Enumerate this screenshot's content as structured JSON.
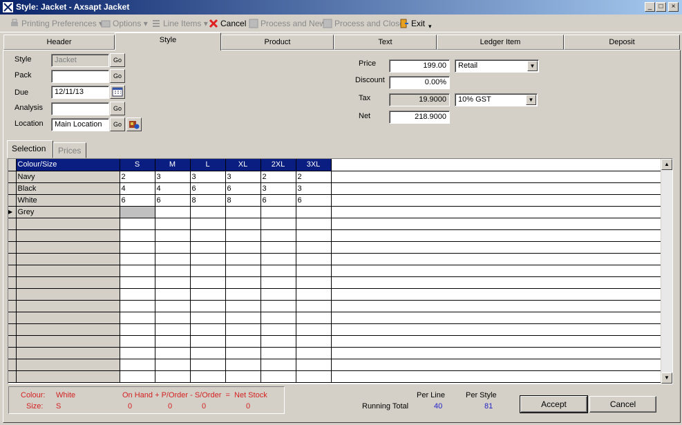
{
  "window": {
    "title": "Style: Jacket - Axsapt Jacket",
    "min": "_",
    "max": "□",
    "close": "×"
  },
  "toolbar": {
    "printing": "Printing Preferences ▾",
    "options": "Options ▾",
    "line_items": "Line Items ▾",
    "cancel": "Cancel",
    "process_new": "Process and New",
    "process_close": "Process and Close",
    "exit": "Exit",
    "more": "▾"
  },
  "tabs": [
    "Header",
    "Style",
    "Product",
    "Text",
    "Ledger Item",
    "Deposit"
  ],
  "form": {
    "style_label": "Style",
    "style_value": "Jacket",
    "pack_label": "Pack",
    "pack_value": "",
    "due_label": "Due",
    "due_value": "12/11/13",
    "analysis_label": "Analysis",
    "analysis_value": "",
    "location_label": "Location",
    "location_value": "Main Location",
    "go": "Go"
  },
  "pricing": {
    "price_label": "Price",
    "price_value": "199.00",
    "price_type": "Retail",
    "discount_label": "Discount",
    "discount_value": "0.00%",
    "tax_label": "Tax",
    "tax_value": "19.9000",
    "tax_type": "10% GST",
    "net_label": "Net",
    "net_value": "218.9000"
  },
  "subtabs": [
    "Selection",
    "Prices"
  ],
  "grid": {
    "header": [
      "Colour/Size",
      "S",
      "M",
      "L",
      "XL",
      "2XL",
      "3XL"
    ],
    "rows": [
      [
        "Navy",
        "2",
        "3",
        "3",
        "3",
        "2",
        "2"
      ],
      [
        "Black",
        "4",
        "4",
        "6",
        "6",
        "3",
        "3"
      ],
      [
        "White",
        "6",
        "6",
        "8",
        "8",
        "6",
        "6"
      ],
      [
        "Grey",
        "",
        "",
        "",
        "",
        "",
        ""
      ]
    ],
    "current_marker": "▶",
    "scroll_up": "▲",
    "scroll_down": "▼"
  },
  "status": {
    "colour_label": "Colour:",
    "colour_value": "White",
    "size_label": "Size:",
    "size_value": "S",
    "formula": "On Hand + P/Order - S/Order  =  Net Stock",
    "on_hand": "0",
    "p_order": "0",
    "s_order": "0",
    "net_stock": "0"
  },
  "totals": {
    "per_line_label": "Per Line",
    "per_style_label": "Per Style",
    "running_total_label": "Running Total",
    "per_line_value": "40",
    "per_style_value": "81"
  },
  "buttons": {
    "accept": "Accept",
    "cancel": "Cancel"
  }
}
